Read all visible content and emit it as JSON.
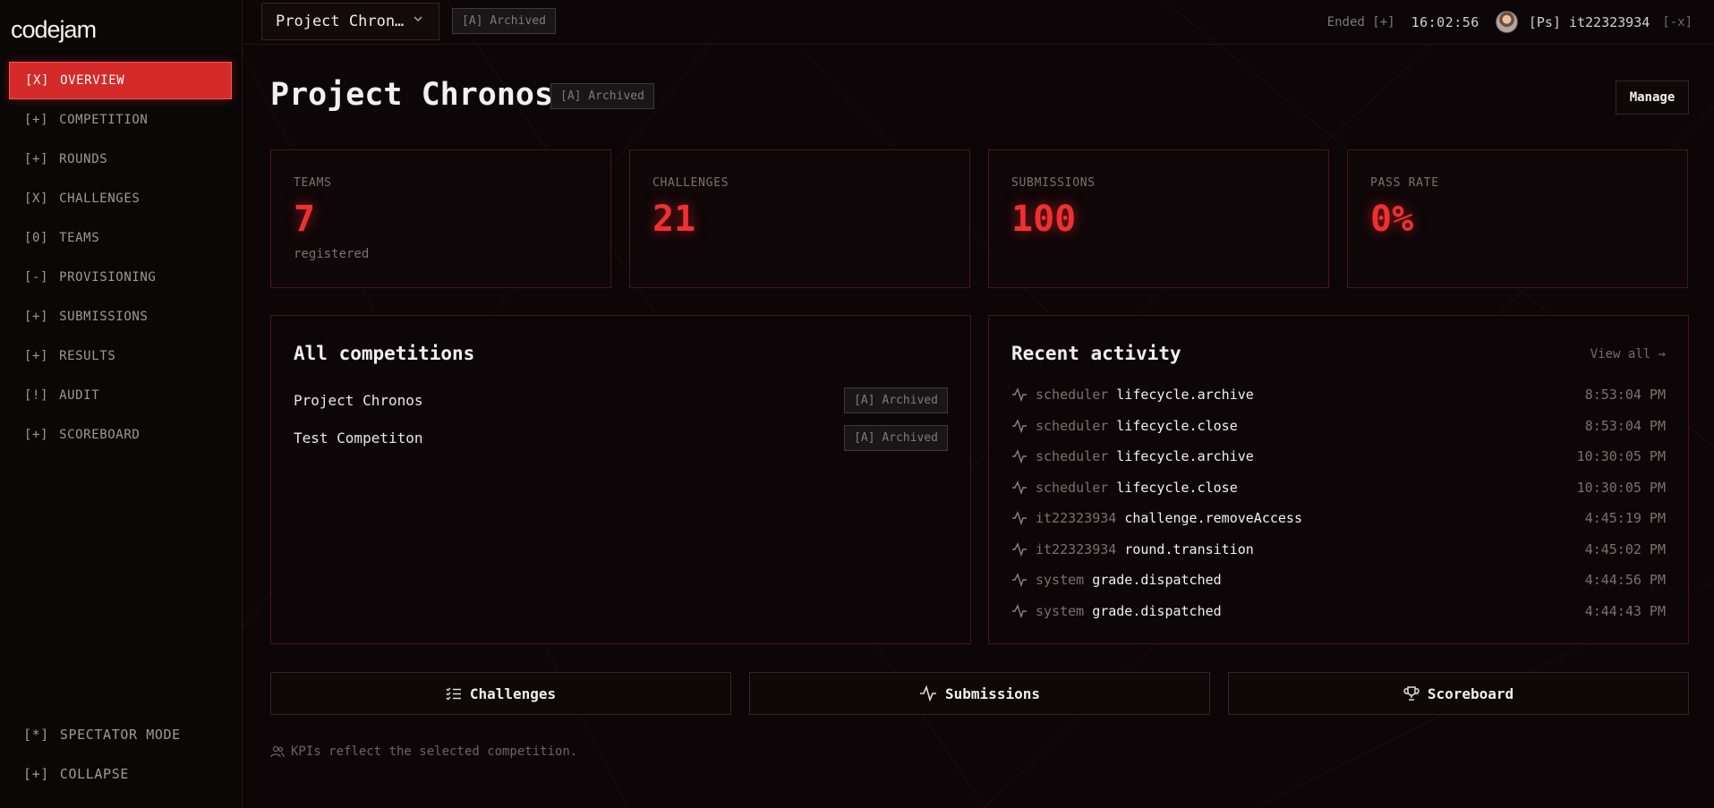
{
  "app": {
    "logo": "codejam"
  },
  "sidebar": {
    "items": [
      {
        "prefix": "[X]",
        "label": "OVERVIEW",
        "active": true
      },
      {
        "prefix": "[+]",
        "label": "COMPETITION"
      },
      {
        "prefix": "[+]",
        "label": "ROUNDS"
      },
      {
        "prefix": "[X]",
        "label": "CHALLENGES"
      },
      {
        "prefix": "[0]",
        "label": "TEAMS"
      },
      {
        "prefix": "[-]",
        "label": "PROVISIONING"
      },
      {
        "prefix": "[+]",
        "label": "SUBMISSIONS"
      },
      {
        "prefix": "[+]",
        "label": "RESULTS"
      },
      {
        "prefix": "[!]",
        "label": "AUDIT"
      },
      {
        "prefix": "[+]",
        "label": "SCOREBOARD"
      }
    ],
    "spectator": {
      "prefix": "[*]",
      "label": "SPECTATOR MODE"
    },
    "collapse": {
      "prefix": "[+]",
      "label": "COLLAPSE"
    }
  },
  "topbar": {
    "competition_select": "Project Chron…",
    "status_badge": "[A] Archived",
    "ended": "Ended [+]",
    "clock": "16:02:56",
    "user": "[Ps] it22323934",
    "logout": "[-x]"
  },
  "header": {
    "title": "Project Chronos",
    "badge": "[A] Archived",
    "manage": "Manage"
  },
  "kpis": [
    {
      "label": "TEAMS",
      "value": "7",
      "sub": "registered"
    },
    {
      "label": "CHALLENGES",
      "value": "21",
      "sub": ""
    },
    {
      "label": "SUBMISSIONS",
      "value": "100",
      "sub": ""
    },
    {
      "label": "PASS RATE",
      "value": "0%",
      "sub": ""
    }
  ],
  "competitions": {
    "title": "All competitions",
    "items": [
      {
        "name": "Project Chronos",
        "badge": "[A] Archived"
      },
      {
        "name": "Test Competiton",
        "badge": "[A] Archived"
      }
    ]
  },
  "activity": {
    "title": "Recent activity",
    "view_all": "View all →",
    "items": [
      {
        "actor": "scheduler",
        "action": "lifecycle.archive",
        "time": "8:53:04 PM"
      },
      {
        "actor": "scheduler",
        "action": "lifecycle.close",
        "time": "8:53:04 PM"
      },
      {
        "actor": "scheduler",
        "action": "lifecycle.archive",
        "time": "10:30:05 PM"
      },
      {
        "actor": "scheduler",
        "action": "lifecycle.close",
        "time": "10:30:05 PM"
      },
      {
        "actor": "it22323934",
        "action": "challenge.removeAccess",
        "time": "4:45:19 PM"
      },
      {
        "actor": "it22323934",
        "action": "round.transition",
        "time": "4:45:02 PM"
      },
      {
        "actor": "system",
        "action": "grade.dispatched",
        "time": "4:44:56 PM"
      },
      {
        "actor": "system",
        "action": "grade.dispatched",
        "time": "4:44:43 PM"
      }
    ]
  },
  "quick_links": {
    "challenges": "Challenges",
    "submissions": "Submissions",
    "scoreboard": "Scoreboard"
  },
  "footnote": "KPIs reflect the selected competition.",
  "colors": {
    "accent": "#d42a2a",
    "kpi_value": "#ef3030",
    "border": "#4a1618"
  }
}
